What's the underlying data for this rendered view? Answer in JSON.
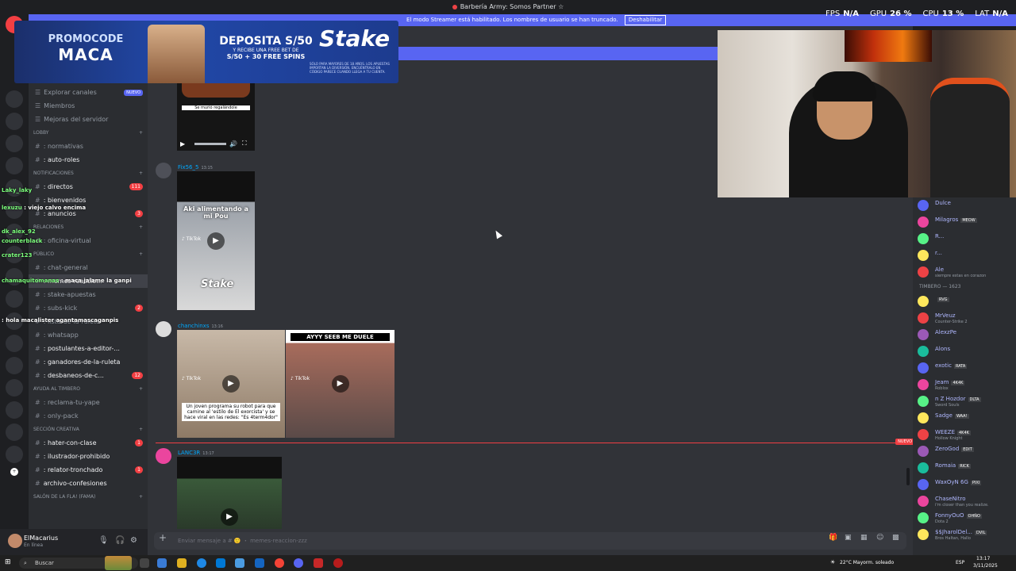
{
  "window": {
    "title": "Barbería Army: Somos Partner ☆"
  },
  "streamer_banner": {
    "text": "El modo Streamer está habilitado. Los nombres de usuario se han truncado.",
    "button": "Deshabilitar"
  },
  "stats": {
    "fps_label": "FPS",
    "fps": "N/A",
    "gpu_label": "GPU",
    "gpu": "26 %",
    "cpu_label": "CPU",
    "cpu": "13 %",
    "lat_label": "LAT",
    "lat": "N/A"
  },
  "promo": {
    "code_label": "PROMOCODE",
    "code": "MACA",
    "deposit": "DEPOSITA S/50",
    "deposit_sub": "Y RECIBE UNA FREE BET DE",
    "deposit_offer": "S/50 + 30 FREE SPINS",
    "brand": "Stake",
    "fine_print": "SÓLO PARA MAYORES DE 18 AÑOS. LOS APUESTAS IMPORTAN LA DIVERSIÓN. ENCUÉNTRALO EN CÓDIGO PARECE CUANDO LLEGA A TU CUENTA."
  },
  "sidebar": {
    "items": [
      {
        "label": "Explorar canales",
        "badge": "NUEVO",
        "kind": "top"
      },
      {
        "label": "Miembros",
        "kind": "top"
      },
      {
        "label": "Mejoras del servidor",
        "kind": "top"
      },
      {
        "label": "LOBBY",
        "kind": "cat"
      },
      {
        "label": ": normativas",
        "kind": "chan"
      },
      {
        "label": ": auto-roles",
        "kind": "chan",
        "bright": true
      },
      {
        "label": "NOTIFICACIONES",
        "kind": "cat"
      },
      {
        "label": ": directos",
        "kind": "chan",
        "bright": true,
        "badge": "111"
      },
      {
        "label": ": bienvenidos",
        "kind": "chan",
        "bright": true
      },
      {
        "label": ": anuncios",
        "kind": "chan",
        "bright": true,
        "badge": "3"
      },
      {
        "label": "RELACIONES",
        "kind": "cat"
      },
      {
        "label": ": oficina-virtual",
        "kind": "chan"
      },
      {
        "label": "PÚBLICO",
        "kind": "cat"
      },
      {
        "label": ": chat-general",
        "kind": "chan"
      },
      {
        "label": ": memes-reaccio...",
        "kind": "chan",
        "active": true
      },
      {
        "label": ": stake-apuestas",
        "kind": "chan"
      },
      {
        "label": ": subs-kick",
        "kind": "chan",
        "badge": "2"
      },
      {
        "label": ": lista-de-la-ruleta",
        "kind": "chan"
      },
      {
        "label": ": whatsapp",
        "kind": "chan"
      },
      {
        "label": ": postulantes-a-editor-...",
        "kind": "chan",
        "bright": true
      },
      {
        "label": ": ganadores-de-la-ruleta",
        "kind": "chan",
        "bright": true
      },
      {
        "label": ": desbaneos-de-c...",
        "kind": "chan",
        "bright": true,
        "badge": "12"
      },
      {
        "label": "AYUDA AL TIMBERO",
        "kind": "cat"
      },
      {
        "label": ": reclama-tu-yape",
        "kind": "chan"
      },
      {
        "label": ": only-pack",
        "kind": "chan"
      },
      {
        "label": "SECCIÓN CREATIVA",
        "kind": "cat"
      },
      {
        "label": ": hater-con-clase",
        "kind": "chan",
        "bright": true,
        "badge": "1"
      },
      {
        "label": ": ilustrador-prohibido",
        "kind": "chan",
        "bright": true
      },
      {
        "label": ": relator-tronchado",
        "kind": "chan",
        "bright": true,
        "badge": "1"
      },
      {
        "label": "archivo-confesiones",
        "kind": "chan",
        "bright": true
      },
      {
        "label": "SALÓN DE LA FLA! (FAMA)",
        "kind": "cat"
      }
    ]
  },
  "user_panel": {
    "name": "ElMacarius",
    "status": "En línea"
  },
  "messages": [
    {
      "author": "",
      "time": "",
      "captions": [
        "Se murió regalándole"
      ]
    },
    {
      "author": "Fix56_5",
      "time": "13:15",
      "captions": [
        "Aki alimentando a mi Pou"
      ]
    },
    {
      "author": "chanchinxs",
      "time": "13:16",
      "captions": [
        "Un joven programa su robot para que camine al 'estilo de El exorcista' y se hace viral en las redes: \"Es 4term4dor\"",
        "AYYY SEEB ME DUELE"
      ]
    },
    {
      "author": "LANC3R",
      "time": "13:17",
      "captions": [
        ""
      ]
    }
  ],
  "new_marker": "NUEVO",
  "composer": {
    "placeholder": "Enviar mensaje a # 🙂 ・ memes-reaccion-zzz"
  },
  "members": {
    "top": [
      {
        "name": "Dulce",
        "status": ""
      },
      {
        "name": "Milagros",
        "tag": "MEOW",
        "status": ""
      },
      {
        "name": "R...",
        "status": ""
      },
      {
        "name": "r...",
        "status": ""
      },
      {
        "name": "Ale",
        "status": "siempre estas en corazon"
      }
    ],
    "category": "TIMBERO — 1623",
    "list": [
      {
        "name": "",
        "tag": "RVG",
        "status": ""
      },
      {
        "name": "MrVeuz",
        "status": "Counter-Strike 2"
      },
      {
        "name": "AlexzPe",
        "status": ""
      },
      {
        "name": "Alons",
        "status": ""
      },
      {
        "name": "exotic",
        "tag": "RATA",
        "status": ""
      },
      {
        "name": "Jeam",
        "tag": "4K4K",
        "status": "Roblox"
      },
      {
        "name": "n Z Hozdor",
        "tag": "DLTA",
        "status": "Sword Souls"
      },
      {
        "name": "Sadge",
        "tag": "WAA!",
        "status": ""
      },
      {
        "name": "WEEZE",
        "tag": "4K4K",
        "status": "Hollow Knight"
      },
      {
        "name": "ZeroGod",
        "tag": "EDIT",
        "status": ""
      },
      {
        "name": "Romaia",
        "tag": "RICK",
        "status": ""
      },
      {
        "name": "WaxOyN 6G",
        "tag": "PIXI",
        "status": ""
      },
      {
        "name": "ChaseNitro",
        "status": "i'm closer than you realize."
      },
      {
        "name": "FonnyOuO",
        "tag": "OHÑO",
        "status": "Dota 2"
      },
      {
        "name": "$$JharolDel...",
        "tag": "DVIL",
        "status": "Bros Haltan, Hallo"
      }
    ]
  },
  "stream_chat": [
    {
      "user": "Laky_laky",
      "text": ""
    },
    {
      "user": "lexuzu",
      "text": "viejo calvo encima"
    },
    {
      "user": "dk_alex_92",
      "text": ""
    },
    {
      "user": "counterblack",
      "text": ""
    },
    {
      "user": "crater123",
      "text": ""
    },
    {
      "user": "chamaquitomanas",
      "text": "maca jalame la ganpi"
    },
    {
      "user": "",
      "text": "hola macalister agantamascaganpis"
    }
  ],
  "taskbar": {
    "search": "Buscar",
    "weather": "22°C Mayorm. soleado",
    "lang": "ESP",
    "time": "13:17",
    "date": "3/11/2025"
  },
  "colors": {
    "blurple": "#5865f2",
    "red": "#f23f43",
    "link": "#00a8fc"
  }
}
